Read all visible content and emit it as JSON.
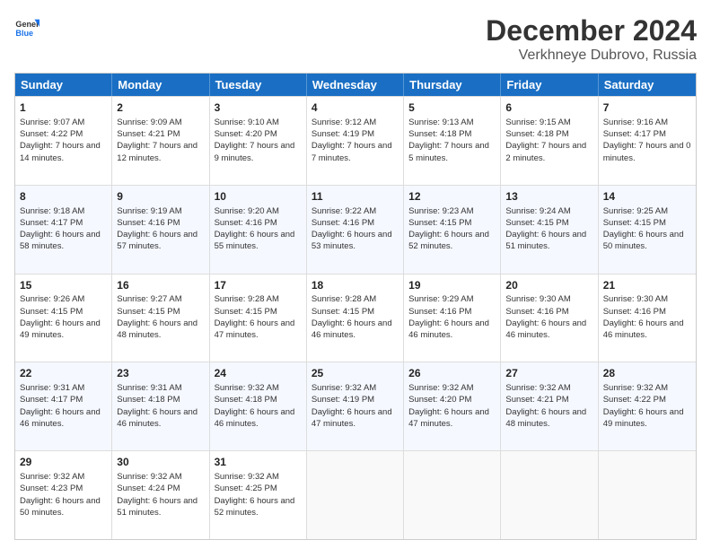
{
  "logo": {
    "text_general": "General",
    "text_blue": "Blue"
  },
  "title": "December 2024",
  "location": "Verkhneye Dubrovo, Russia",
  "days_of_week": [
    "Sunday",
    "Monday",
    "Tuesday",
    "Wednesday",
    "Thursday",
    "Friday",
    "Saturday"
  ],
  "weeks": [
    [
      {
        "day": "1",
        "sunrise": "Sunrise: 9:07 AM",
        "sunset": "Sunset: 4:22 PM",
        "daylight": "Daylight: 7 hours and 14 minutes."
      },
      {
        "day": "2",
        "sunrise": "Sunrise: 9:09 AM",
        "sunset": "Sunset: 4:21 PM",
        "daylight": "Daylight: 7 hours and 12 minutes."
      },
      {
        "day": "3",
        "sunrise": "Sunrise: 9:10 AM",
        "sunset": "Sunset: 4:20 PM",
        "daylight": "Daylight: 7 hours and 9 minutes."
      },
      {
        "day": "4",
        "sunrise": "Sunrise: 9:12 AM",
        "sunset": "Sunset: 4:19 PM",
        "daylight": "Daylight: 7 hours and 7 minutes."
      },
      {
        "day": "5",
        "sunrise": "Sunrise: 9:13 AM",
        "sunset": "Sunset: 4:18 PM",
        "daylight": "Daylight: 7 hours and 5 minutes."
      },
      {
        "day": "6",
        "sunrise": "Sunrise: 9:15 AM",
        "sunset": "Sunset: 4:18 PM",
        "daylight": "Daylight: 7 hours and 2 minutes."
      },
      {
        "day": "7",
        "sunrise": "Sunrise: 9:16 AM",
        "sunset": "Sunset: 4:17 PM",
        "daylight": "Daylight: 7 hours and 0 minutes."
      }
    ],
    [
      {
        "day": "8",
        "sunrise": "Sunrise: 9:18 AM",
        "sunset": "Sunset: 4:17 PM",
        "daylight": "Daylight: 6 hours and 58 minutes."
      },
      {
        "day": "9",
        "sunrise": "Sunrise: 9:19 AM",
        "sunset": "Sunset: 4:16 PM",
        "daylight": "Daylight: 6 hours and 57 minutes."
      },
      {
        "day": "10",
        "sunrise": "Sunrise: 9:20 AM",
        "sunset": "Sunset: 4:16 PM",
        "daylight": "Daylight: 6 hours and 55 minutes."
      },
      {
        "day": "11",
        "sunrise": "Sunrise: 9:22 AM",
        "sunset": "Sunset: 4:16 PM",
        "daylight": "Daylight: 6 hours and 53 minutes."
      },
      {
        "day": "12",
        "sunrise": "Sunrise: 9:23 AM",
        "sunset": "Sunset: 4:15 PM",
        "daylight": "Daylight: 6 hours and 52 minutes."
      },
      {
        "day": "13",
        "sunrise": "Sunrise: 9:24 AM",
        "sunset": "Sunset: 4:15 PM",
        "daylight": "Daylight: 6 hours and 51 minutes."
      },
      {
        "day": "14",
        "sunrise": "Sunrise: 9:25 AM",
        "sunset": "Sunset: 4:15 PM",
        "daylight": "Daylight: 6 hours and 50 minutes."
      }
    ],
    [
      {
        "day": "15",
        "sunrise": "Sunrise: 9:26 AM",
        "sunset": "Sunset: 4:15 PM",
        "daylight": "Daylight: 6 hours and 49 minutes."
      },
      {
        "day": "16",
        "sunrise": "Sunrise: 9:27 AM",
        "sunset": "Sunset: 4:15 PM",
        "daylight": "Daylight: 6 hours and 48 minutes."
      },
      {
        "day": "17",
        "sunrise": "Sunrise: 9:28 AM",
        "sunset": "Sunset: 4:15 PM",
        "daylight": "Daylight: 6 hours and 47 minutes."
      },
      {
        "day": "18",
        "sunrise": "Sunrise: 9:28 AM",
        "sunset": "Sunset: 4:15 PM",
        "daylight": "Daylight: 6 hours and 46 minutes."
      },
      {
        "day": "19",
        "sunrise": "Sunrise: 9:29 AM",
        "sunset": "Sunset: 4:16 PM",
        "daylight": "Daylight: 6 hours and 46 minutes."
      },
      {
        "day": "20",
        "sunrise": "Sunrise: 9:30 AM",
        "sunset": "Sunset: 4:16 PM",
        "daylight": "Daylight: 6 hours and 46 minutes."
      },
      {
        "day": "21",
        "sunrise": "Sunrise: 9:30 AM",
        "sunset": "Sunset: 4:16 PM",
        "daylight": "Daylight: 6 hours and 46 minutes."
      }
    ],
    [
      {
        "day": "22",
        "sunrise": "Sunrise: 9:31 AM",
        "sunset": "Sunset: 4:17 PM",
        "daylight": "Daylight: 6 hours and 46 minutes."
      },
      {
        "day": "23",
        "sunrise": "Sunrise: 9:31 AM",
        "sunset": "Sunset: 4:18 PM",
        "daylight": "Daylight: 6 hours and 46 minutes."
      },
      {
        "day": "24",
        "sunrise": "Sunrise: 9:32 AM",
        "sunset": "Sunset: 4:18 PM",
        "daylight": "Daylight: 6 hours and 46 minutes."
      },
      {
        "day": "25",
        "sunrise": "Sunrise: 9:32 AM",
        "sunset": "Sunset: 4:19 PM",
        "daylight": "Daylight: 6 hours and 47 minutes."
      },
      {
        "day": "26",
        "sunrise": "Sunrise: 9:32 AM",
        "sunset": "Sunset: 4:20 PM",
        "daylight": "Daylight: 6 hours and 47 minutes."
      },
      {
        "day": "27",
        "sunrise": "Sunrise: 9:32 AM",
        "sunset": "Sunset: 4:21 PM",
        "daylight": "Daylight: 6 hours and 48 minutes."
      },
      {
        "day": "28",
        "sunrise": "Sunrise: 9:32 AM",
        "sunset": "Sunset: 4:22 PM",
        "daylight": "Daylight: 6 hours and 49 minutes."
      }
    ],
    [
      {
        "day": "29",
        "sunrise": "Sunrise: 9:32 AM",
        "sunset": "Sunset: 4:23 PM",
        "daylight": "Daylight: 6 hours and 50 minutes."
      },
      {
        "day": "30",
        "sunrise": "Sunrise: 9:32 AM",
        "sunset": "Sunset: 4:24 PM",
        "daylight": "Daylight: 6 hours and 51 minutes."
      },
      {
        "day": "31",
        "sunrise": "Sunrise: 9:32 AM",
        "sunset": "Sunset: 4:25 PM",
        "daylight": "Daylight: 6 hours and 52 minutes."
      },
      {
        "day": "",
        "sunrise": "",
        "sunset": "",
        "daylight": ""
      },
      {
        "day": "",
        "sunrise": "",
        "sunset": "",
        "daylight": ""
      },
      {
        "day": "",
        "sunrise": "",
        "sunset": "",
        "daylight": ""
      },
      {
        "day": "",
        "sunrise": "",
        "sunset": "",
        "daylight": ""
      }
    ]
  ]
}
